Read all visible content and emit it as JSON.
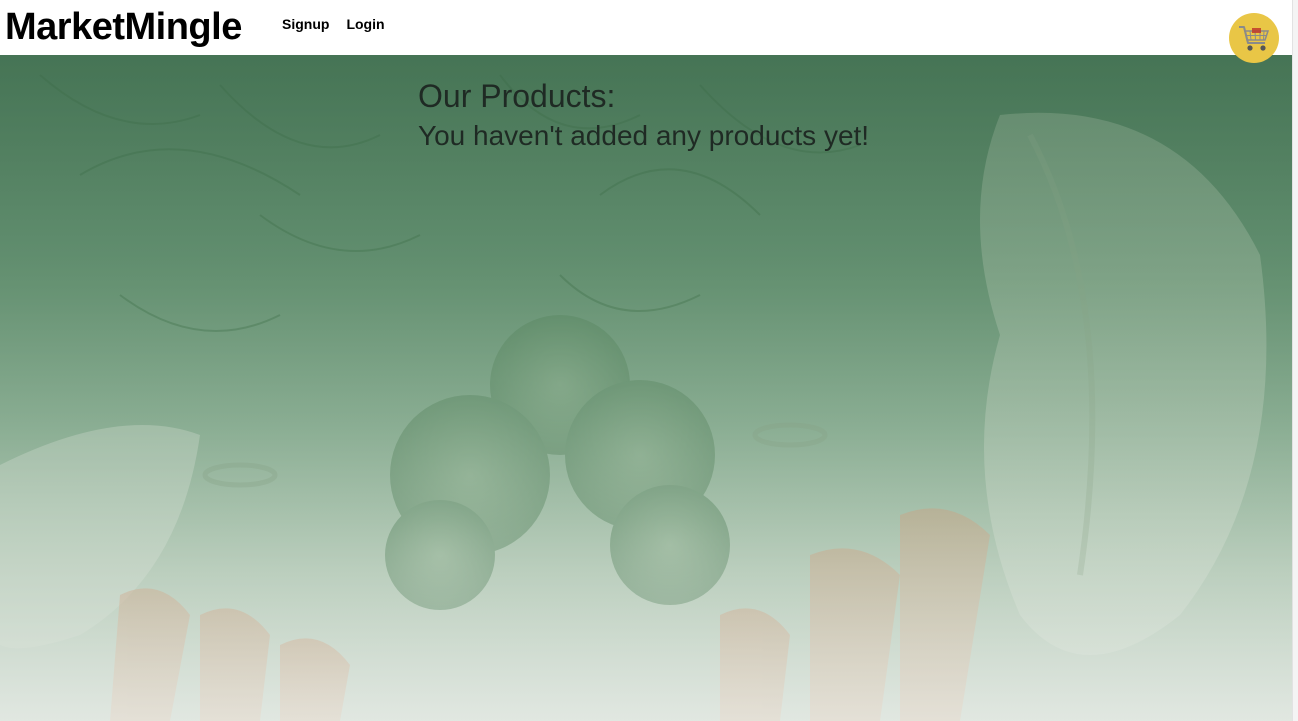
{
  "navbar": {
    "brand": "MarketMingle",
    "links": [
      {
        "label": "Signup"
      },
      {
        "label": "Login"
      }
    ],
    "cart_icon": "shopping-cart-icon"
  },
  "main": {
    "title": "Our Products:",
    "empty_message": "You haven't added any products yet!"
  },
  "colors": {
    "cart_button": "#e9c646",
    "background_top": "#4f7b5d",
    "background_bottom": "#dbe3db"
  }
}
